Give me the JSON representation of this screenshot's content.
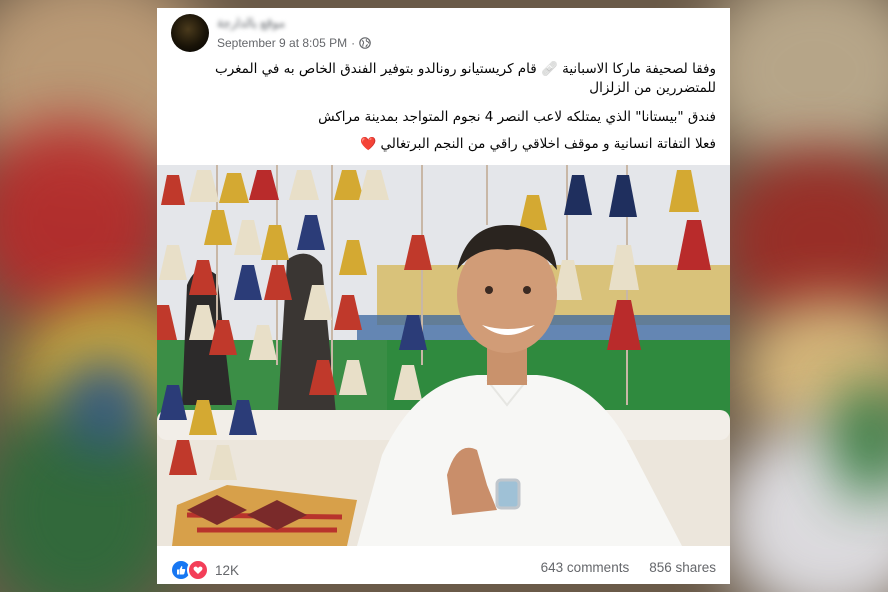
{
  "post": {
    "author_name": "موقع بالدارجة",
    "timestamp": "September 9 at 8:05 PM",
    "separator": "·",
    "privacy_icon": "globe-icon",
    "text_line1": "وفقا لصحيفة ماركا الاسبانية 🩹 قام كريستيانو رونالدو بتوفير الفندق الخاص به في المغرب للمتضررين من الزلزال",
    "text_line2": "فندق \"بيستانا\" الذي يمتلكه لاعب النصر 4 نجوم المتواجد بمدينة مراكش",
    "text_line3": "فعلا التفاتة انسانية و موقف اخلاقي راقي من النجم البرتغالي",
    "text_line3_emoji": "❤️"
  },
  "footer": {
    "reactions_icons": [
      "like-icon",
      "love-icon"
    ],
    "reactions_count": "12K",
    "comments": "643 comments",
    "shares": "856 shares"
  },
  "colors": {
    "like_blue": "#1877f2",
    "love_red": "#f33e58",
    "meta_gray": "#65676b"
  }
}
